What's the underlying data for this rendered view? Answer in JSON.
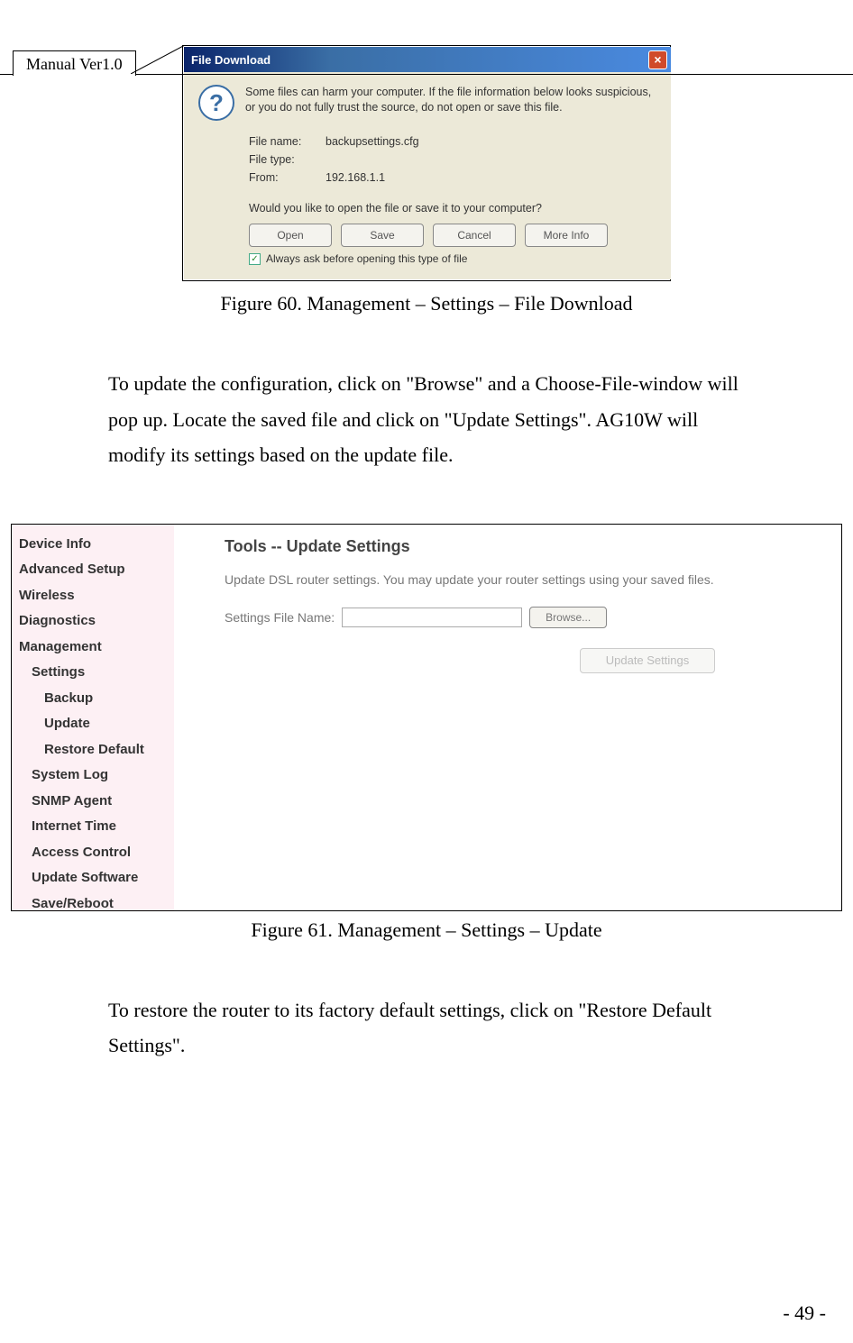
{
  "header": {
    "tag": "Manual Ver1.0"
  },
  "fig60": {
    "title": "File Download",
    "warning": "Some files can harm your computer. If the file information below looks suspicious, or you do not fully trust the source, do not open or save this file.",
    "fields": {
      "filename_lbl": "File name:",
      "filename_val": "backupsettings.cfg",
      "filetype_lbl": "File type:",
      "filetype_val": "",
      "from_lbl": "From:",
      "from_val": "192.168.1.1"
    },
    "prompt": "Would you like to open the file or save it to your computer?",
    "buttons": {
      "open": "Open",
      "save": "Save",
      "cancel": "Cancel",
      "more": "More Info"
    },
    "checkbox": "Always ask before opening this type of file",
    "caption": "Figure 60. Management – Settings – File Download"
  },
  "para1": "To update the configuration, click on \"Browse\" and a Choose-File-window will pop up. Locate the saved file and click on \"Update Settings\". AG10W will modify its settings based on the update file.",
  "fig61": {
    "nav": {
      "n1": "Device Info",
      "n2": "Advanced Setup",
      "n3": "Wireless",
      "n4": "Diagnostics",
      "n5": "Management",
      "n5a": "Settings",
      "n5a1": "Backup",
      "n5a2": "Update",
      "n5a3": "Restore Default",
      "n5b": "System Log",
      "n5c": "SNMP Agent",
      "n5d": "Internet Time",
      "n5e": "Access Control",
      "n5f": "Update Software",
      "n5g": "Save/Reboot"
    },
    "title": "Tools -- Update Settings",
    "desc": "Update DSL router settings. You may update your router settings using your saved files.",
    "label": "Settings File Name:",
    "browse": "Browse...",
    "update": "Update Settings",
    "caption": "Figure 61. Management – Settings – Update"
  },
  "para2": "To restore the router to its factory default settings, click on \"Restore Default Settings\".",
  "page": "- 49 -"
}
